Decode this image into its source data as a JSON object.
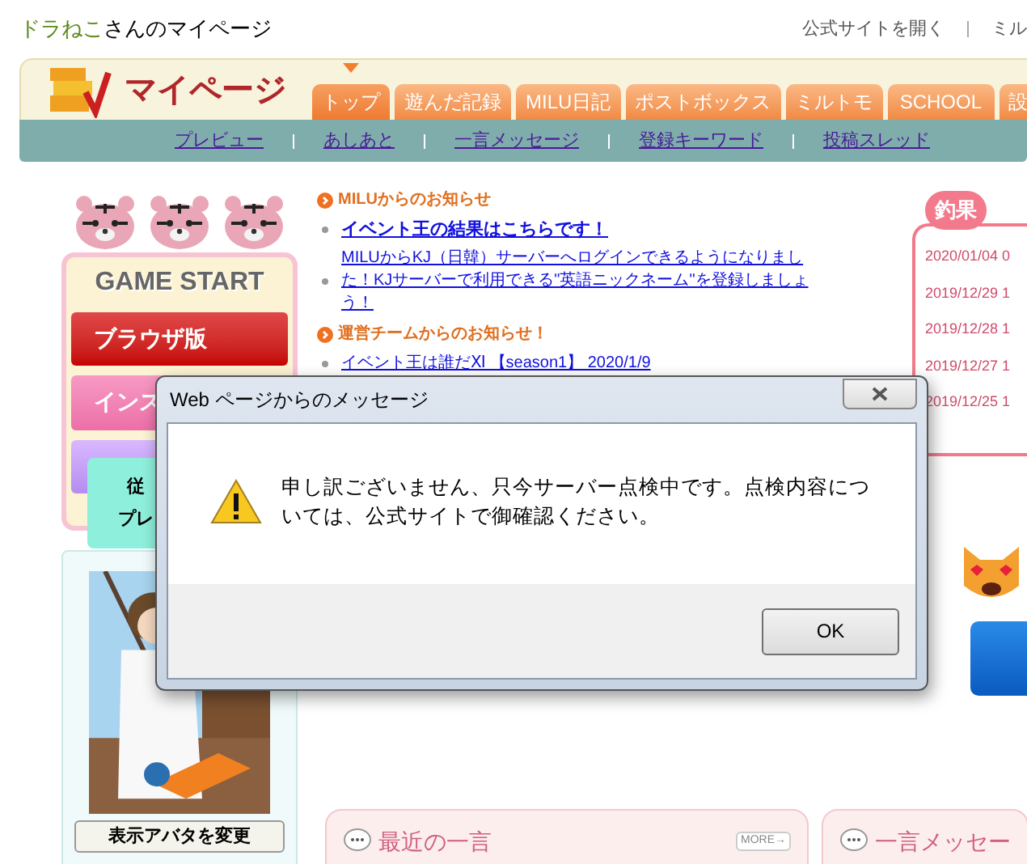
{
  "header": {
    "user_name": "ドラねこ",
    "title_suffix": "さんのマイページ",
    "links": [
      "公式サイトを開く",
      "ミル"
    ]
  },
  "logo": {
    "title": "マイページ"
  },
  "tabs": [
    {
      "label": "トップ",
      "selected": true
    },
    {
      "label": "遊んだ記録",
      "selected": false
    },
    {
      "label": "MILU日記",
      "selected": false
    },
    {
      "label": "ポストボックス",
      "selected": false
    },
    {
      "label": "ミルトモ",
      "selected": false
    },
    {
      "label": "SCHOOL",
      "selected": false
    },
    {
      "label": "設",
      "selected": false
    }
  ],
  "subnav": [
    "プレビュー",
    "あしあと",
    "一言メッセージ",
    "登録キーワード",
    "投稿スレッド"
  ],
  "game_start": {
    "title": "GAME START",
    "buttons": [
      {
        "label": "ブラウザ版",
        "kind": "red"
      },
      {
        "label": "インス",
        "kind": "pink"
      },
      {
        "kind": "purple"
      }
    ],
    "tooltip": [
      "従",
      "プレ"
    ]
  },
  "avatar": {
    "button": "表示アバタを変更"
  },
  "news": [
    {
      "heading": "MILUからのお知らせ",
      "items": [
        {
          "text": "イベント王の結果はこちらです！",
          "bold": true
        },
        {
          "text": "MILUからKJ（日韓）サーバーへログインできるようになりました！KJサーバーで利用できる\"英語ニックネーム\"を登録しましょう！",
          "bold": false
        }
      ]
    },
    {
      "heading": "運営チームからのお知らせ！",
      "items": [
        {
          "text": "イベント王は誰だⅪ 【season1】 2020/1/9",
          "bold": false
        }
      ]
    }
  ],
  "catch_panel": {
    "title": "釣果",
    "entries": [
      "2020/01/04 0",
      "2019/12/29 1",
      "2019/12/28 1",
      "2019/12/27 1",
      "2019/12/25 1"
    ]
  },
  "cards": [
    {
      "title": "最近の一言",
      "more": "MORE→"
    },
    {
      "title": "一言メッセー"
    }
  ],
  "dialog": {
    "title": "Web ページからのメッセージ",
    "message": "申し訳ございません、只今サーバー点検中です。点検内容については、公式サイトで御確認ください。",
    "button": "OK"
  }
}
